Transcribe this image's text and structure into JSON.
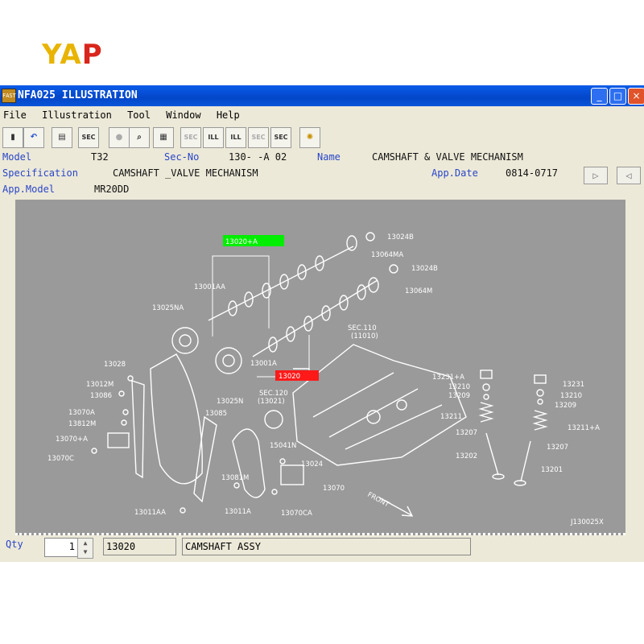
{
  "logo": {
    "y": "Y",
    "a": "A",
    "p": "P"
  },
  "window": {
    "title": "NFA025  ILLUSTRATION",
    "icon_text": "FAST",
    "controls": [
      "_",
      "□",
      "×"
    ]
  },
  "menu": [
    "File",
    "Illustration",
    "Tool",
    "Window",
    "Help"
  ],
  "toolbar": {
    "icons": [
      "exit-icon",
      "undo-icon",
      "print-icon",
      "sec-icon",
      "circle-icon",
      "search-icon",
      "notes-icon",
      "sec-prev-icon",
      "ill-prev-icon",
      "ill-next-icon",
      "sec-next-icon",
      "sec-icon",
      "lightbulb-icon"
    ],
    "labels": {
      "sec": "SEC",
      "ill": "ILL",
      "secx": "SEC"
    }
  },
  "header": {
    "model_label": "Model",
    "model_value": "T32",
    "secno_label": "Sec-No",
    "secno_value": "130-  -A 02",
    "name_label": "Name",
    "name_value": "CAMSHAFT & VALVE MECHANISM",
    "spec_label": "Specification",
    "spec_value": "CAMSHAFT _VALVE MECHANISM",
    "appdate_label": "App.Date",
    "appdate_value": "0814-0717",
    "appmodel_label": "App.Model",
    "appmodel_value": "MR20DD"
  },
  "illustration": {
    "code": "J130025X",
    "front_label": "FRONT",
    "highlight_green": "13020+A",
    "highlight_red": "13020",
    "parts": [
      "13024B",
      "13064MA",
      "13024B",
      "13064M",
      "13001AA",
      "13025NA",
      "13001A",
      "SEC.110",
      "(11010)",
      "13028",
      "13012M",
      "13086",
      "13070A",
      "13812M",
      "13070+A",
      "13070C",
      "13025N",
      "13085",
      "SEC.120",
      "(13021)",
      "15041N",
      "13024",
      "13081M",
      "13011AA",
      "13011A",
      "13070CA",
      "13070",
      "13231+A",
      "13210",
      "13209",
      "13211",
      "13207",
      "13202",
      "13231",
      "13210",
      "13209",
      "13211+A",
      "13207",
      "13201"
    ]
  },
  "footer": {
    "qty_label": "Qty",
    "qty_value": "1",
    "part_no": "13020",
    "part_name": "CAMSHAFT ASSY"
  },
  "colors": {
    "title_bar": "#0346c9",
    "label_blue": "#2a46c8",
    "canvas": "#9a9a9a",
    "highlight_green": "#00ee00",
    "highlight_red": "#ff1a1a"
  }
}
